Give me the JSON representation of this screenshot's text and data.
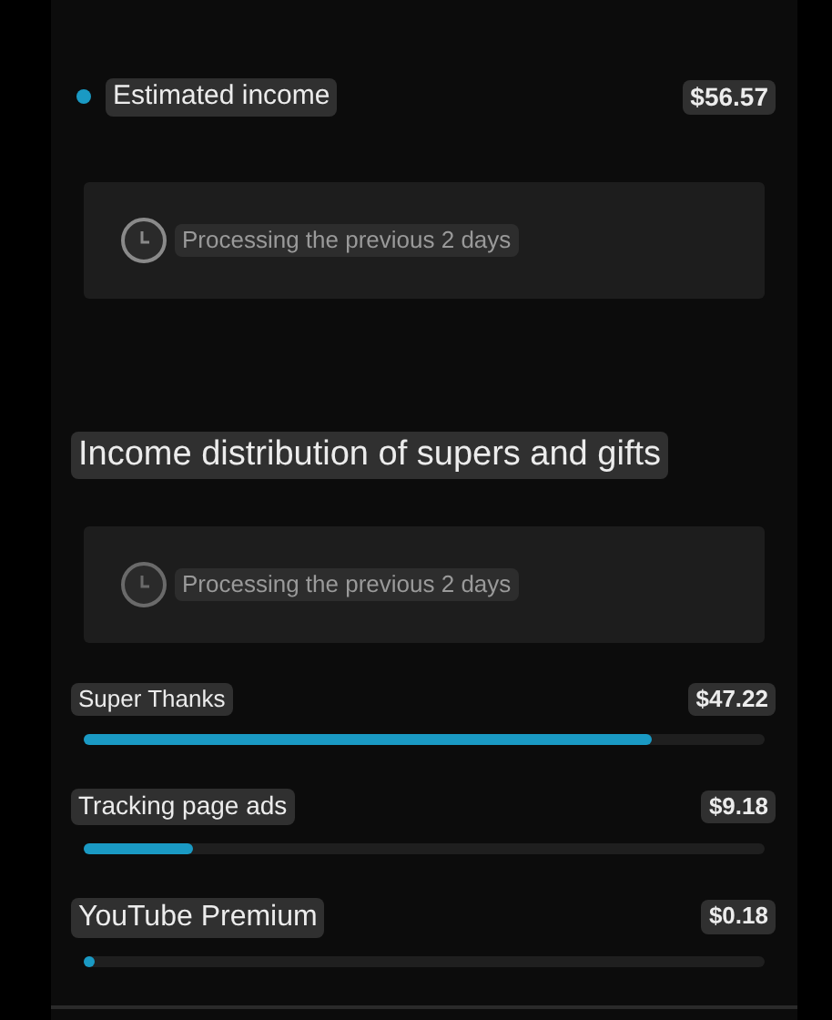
{
  "summary": {
    "label": "Estimated income",
    "amount": "$56.57",
    "color": "#1a9ac4"
  },
  "summary_notice": {
    "text": "Processing the previous 2 days"
  },
  "section_title": "Income distribution of supers and gifts",
  "section_notice": {
    "text": "Processing the previous 2 days"
  },
  "sources": [
    {
      "label": "Super Thanks",
      "amount": "$47.22",
      "level": 0.834
    },
    {
      "label": "Tracking page ads",
      "amount": "$9.18",
      "level": 0.16
    },
    {
      "label": "YouTube Premium",
      "amount": "$0.18",
      "level": 0.01
    }
  ]
}
